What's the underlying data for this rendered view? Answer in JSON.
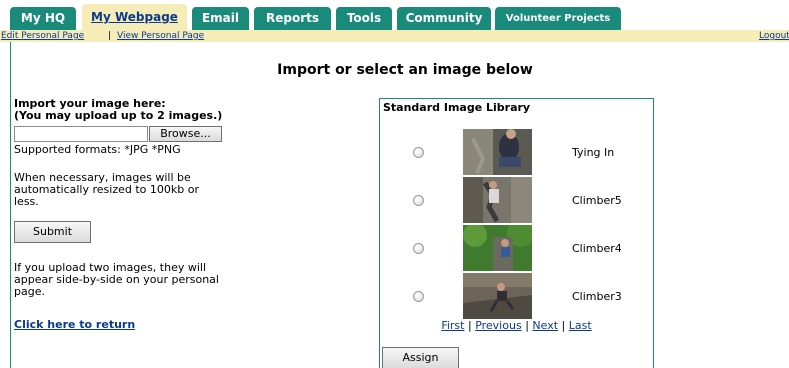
{
  "tabs": [
    {
      "label": "My HQ",
      "active": false
    },
    {
      "label": "My Webpage",
      "active": true
    },
    {
      "label": "Email",
      "active": false
    },
    {
      "label": "Reports",
      "active": false
    },
    {
      "label": "Tools",
      "active": false
    },
    {
      "label": "Community",
      "active": false
    },
    {
      "label": "Volunteer Projects",
      "active": false
    }
  ],
  "subnav": {
    "edit_label": "Edit Personal Page",
    "separator": "|",
    "view_label": "View Personal Page",
    "logout_label": "Logout"
  },
  "page_title": "Import or select an image below",
  "import": {
    "heading_line1": "Import your image here:",
    "heading_line2": "(You may upload up to 2 images.)",
    "file_value": "",
    "browse_label": "Browse...",
    "formats_text": "Supported formats: *JPG *PNG",
    "resize_note": "When necessary, images will be automatically resized to 100kb or less.",
    "submit_label": "Submit",
    "two_images_note": "If you upload two images, they will appear side-by-side on your personal page.",
    "return_link": "Click here to return"
  },
  "library": {
    "title": "Standard Image Library",
    "items": [
      {
        "label": "Tying In",
        "selected": false
      },
      {
        "label": "Climber5",
        "selected": false
      },
      {
        "label": "Climber4",
        "selected": false
      },
      {
        "label": "Climber3",
        "selected": false
      }
    ],
    "pager": {
      "first": "First",
      "previous": "Previous",
      "next": "Next",
      "last": "Last",
      "separator": "|"
    },
    "assign_label": "Assign"
  },
  "colors": {
    "tab_bg": "#1a8a7a",
    "tab_active_bg": "#f6ecb8",
    "link": "#0a3a8c"
  }
}
